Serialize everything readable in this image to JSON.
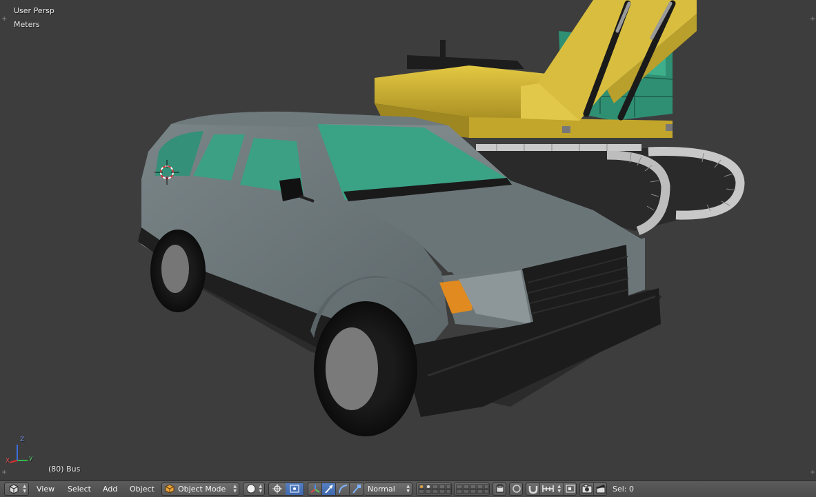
{
  "viewport": {
    "view_label": "User Persp",
    "units_label": "Meters",
    "object_label": "(80) Bus",
    "axis_labels": {
      "x": "X",
      "y": "y",
      "z": "Z"
    }
  },
  "header": {
    "menus": [
      "View",
      "Select",
      "Add",
      "Object"
    ],
    "mode": "Object Mode",
    "orientation": "Normal",
    "sel_count": "Sel: 0"
  },
  "icons": {
    "editor_type": "cube-editor-icon",
    "mode": "orange-cube-icon",
    "shading": "sphere-shading-icon",
    "pivot": "pivot-point-icon",
    "manipulator": [
      "translate-manipulator-icon",
      "rotate-manipulator-icon",
      "scale-manipulator-icon"
    ],
    "render": [
      "camera-render-icon",
      "clapper-render-icon"
    ]
  },
  "colors": {
    "viewport_bg": "#3d3d3d",
    "header_bg": "#555555",
    "active_blue": "#5680c2",
    "car_body": "#727d80",
    "car_glass": "#3a9b7e",
    "excavator_yellow": "#d4b536"
  }
}
